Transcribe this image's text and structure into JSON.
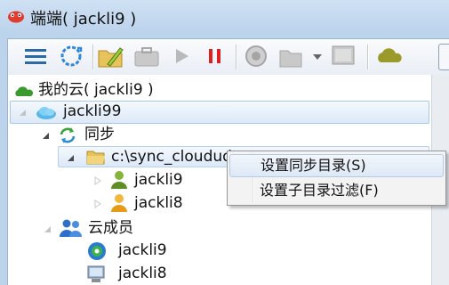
{
  "window": {
    "title": "端端( jackli9 )"
  },
  "toolbar": {
    "buttons": [
      "menu-icon",
      "sync-icon",
      "folder-open-icon",
      "toolbox-icon",
      "play-icon",
      "pause-icon",
      "record-icon",
      "folder-dropdown-icon",
      "monitor-icon",
      "cloud-icon"
    ]
  },
  "tree": {
    "root_label": "我的云( jackli9 )",
    "cloud_label": "jackli99",
    "sync_label": "同步",
    "folder_label": "c:\\sync_cloudud",
    "sync_users": [
      "jackli9",
      "jackli8"
    ],
    "members_label": "云成员",
    "member_devices": [
      "jackli9",
      "jackli8"
    ]
  },
  "context_menu": {
    "items": [
      "设置同步目录(S)",
      "设置子目录过滤(F)"
    ],
    "highlighted_index": 0
  },
  "colors": {
    "titlebar": "#bcd3ec",
    "selection": "#dce9f7",
    "cloud_green": "#3b9a2e",
    "pause_red": "#e02020"
  }
}
